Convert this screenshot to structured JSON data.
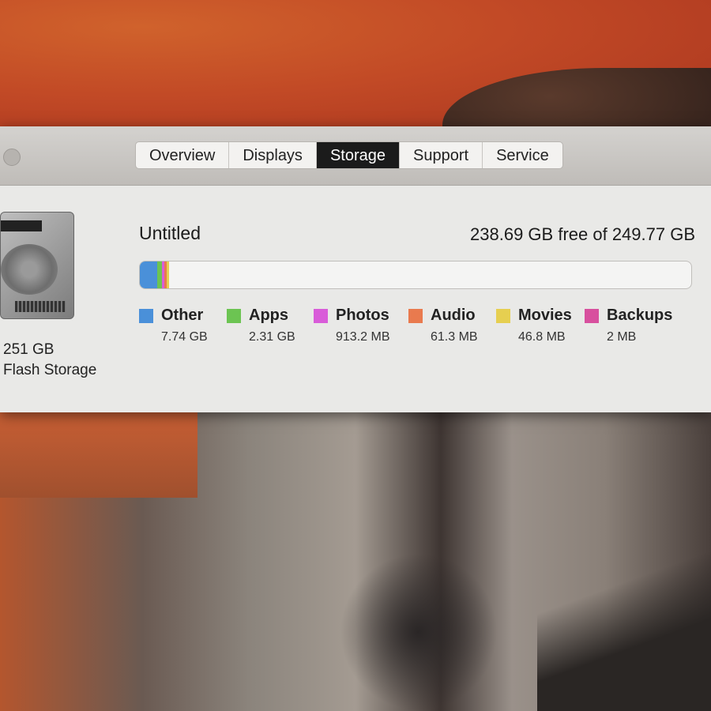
{
  "tabs": [
    {
      "label": "Overview"
    },
    {
      "label": "Displays"
    },
    {
      "label": "Storage",
      "active": true
    },
    {
      "label": "Support"
    },
    {
      "label": "Service"
    }
  ],
  "disk": {
    "capacity": "251 GB",
    "type": "Flash Storage",
    "icon": "hard-disk-icon"
  },
  "volume": {
    "name": "Untitled",
    "free_text": "238.69 GB free of 249.77 GB"
  },
  "usage_gb": {
    "total": 249.77,
    "free": 238.69
  },
  "categories": [
    {
      "label": "Other",
      "value": "7.74 GB",
      "gb": 7.74,
      "color": "#4a90d9"
    },
    {
      "label": "Apps",
      "value": "2.31 GB",
      "gb": 2.31,
      "color": "#6cc452"
    },
    {
      "label": "Photos",
      "value": "913.2 MB",
      "gb": 0.9132,
      "color": "#d95cd9"
    },
    {
      "label": "Audio",
      "value": "61.3 MB",
      "gb": 0.0613,
      "color": "#e97a4e"
    },
    {
      "label": "Movies",
      "value": "46.8 MB",
      "gb": 0.0468,
      "color": "#e6cf50"
    },
    {
      "label": "Backups",
      "value": "2 MB",
      "gb": 0.002,
      "color": "#d8509e"
    }
  ]
}
